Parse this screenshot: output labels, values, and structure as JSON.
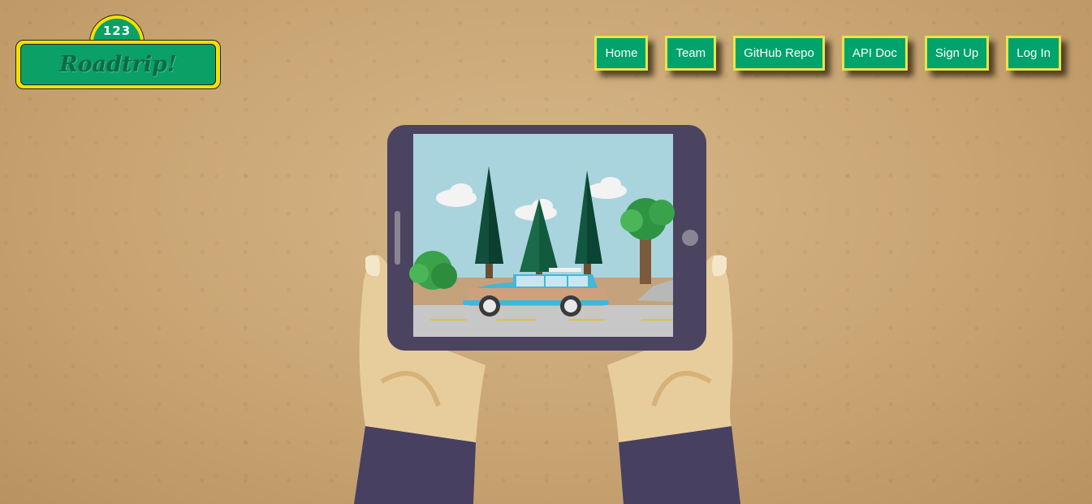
{
  "logo": {
    "badge": "123",
    "text": "Roadtrip!"
  },
  "nav": {
    "items": [
      {
        "label": "Home"
      },
      {
        "label": "Team"
      },
      {
        "label": "GitHub Repo"
      },
      {
        "label": "API Doc"
      },
      {
        "label": "Sign Up"
      },
      {
        "label": "Log In"
      }
    ]
  },
  "colors": {
    "button": "#00a36c",
    "button_border": "#e9e44a",
    "logo_yellow": "#f4e000",
    "tablet": "#4b4460",
    "sleeve": "#474060",
    "skin": "#e7cd9c"
  }
}
